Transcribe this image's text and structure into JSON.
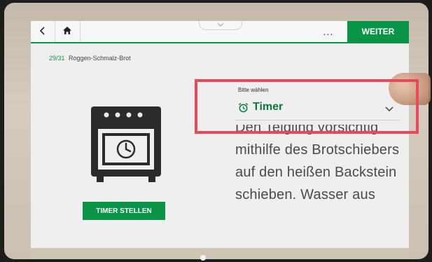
{
  "topbar": {
    "back_icon": "chevron-left-icon",
    "home_icon": "home-icon",
    "more_label": "...",
    "next_label": "WEITER"
  },
  "recipe": {
    "step_count": "29/31",
    "name": "Roggen-Schmalz-Brot"
  },
  "action": {
    "timer_button_label": "TIMER STELLEN"
  },
  "select": {
    "label": "Bitte wählen",
    "value": "Timer",
    "icon": "alarm-clock-icon"
  },
  "instruction_text": "Den Teigling vorsichtig mithilfe des Brotschiebers auf den heißen Backstein schieben. Wasser aus",
  "colors": {
    "accent": "#0a9447",
    "highlight": "#e8495b"
  }
}
